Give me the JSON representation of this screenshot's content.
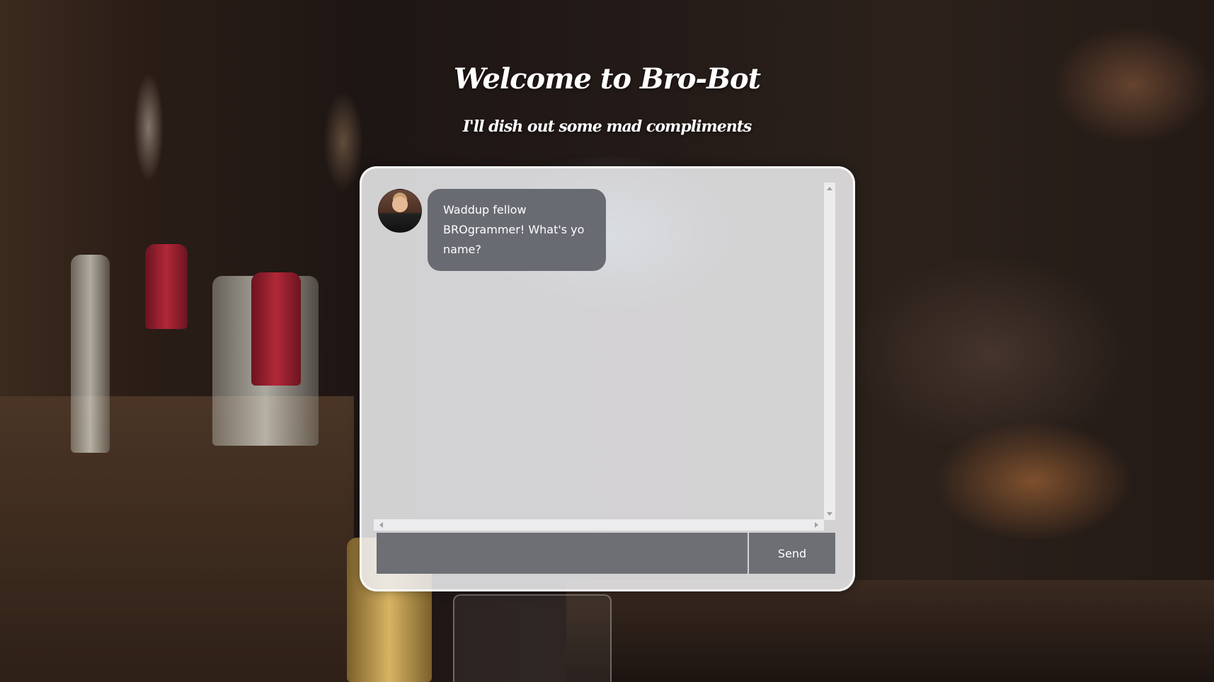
{
  "header": {
    "title": "Welcome to Bro-Bot",
    "subtitle": "I'll dish out some mad compliments"
  },
  "chat": {
    "messages": [
      {
        "sender": "bot",
        "avatar": "barney-avatar",
        "text": "Waddup fellow BROgrammer! What's yo name?"
      }
    ],
    "input": {
      "value": "",
      "placeholder": ""
    },
    "send_label": "Send"
  },
  "colors": {
    "bubble": "#696b72",
    "input": "#6d6f75",
    "panel": "#f0f0f2"
  }
}
